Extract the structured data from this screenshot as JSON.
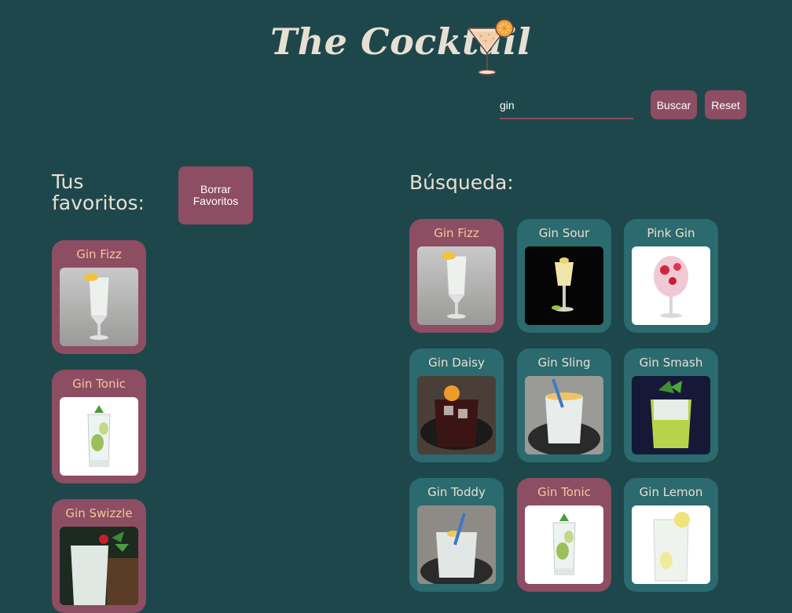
{
  "header": {
    "title": "The Cocktail",
    "logo_icon": "cocktail-glass-icon"
  },
  "search": {
    "value": "gin",
    "buscar_label": "Buscar",
    "reset_label": "Reset"
  },
  "favorites": {
    "heading": "Tus favoritos:",
    "clear_label": "Borrar Favoritos",
    "items": [
      {
        "name": "Gin Fizz"
      },
      {
        "name": "Gin Tonic"
      },
      {
        "name": "Gin Swizzle"
      }
    ]
  },
  "results": {
    "heading": "Búsqueda:",
    "items": [
      {
        "name": "Gin Fizz",
        "favorite": true
      },
      {
        "name": "Gin Sour",
        "favorite": false
      },
      {
        "name": "Pink Gin",
        "favorite": false
      },
      {
        "name": "Gin Daisy",
        "favorite": false
      },
      {
        "name": "Gin Sling",
        "favorite": false
      },
      {
        "name": "Gin Smash",
        "favorite": false
      },
      {
        "name": "Gin Toddy",
        "favorite": false
      },
      {
        "name": "Gin Tonic",
        "favorite": true
      },
      {
        "name": "Gin Lemon",
        "favorite": false
      }
    ]
  },
  "colors": {
    "background": "#1e474b",
    "accent": "#8d4d62",
    "card": "#2b6a6e",
    "fav_text": "#f4c89a"
  }
}
